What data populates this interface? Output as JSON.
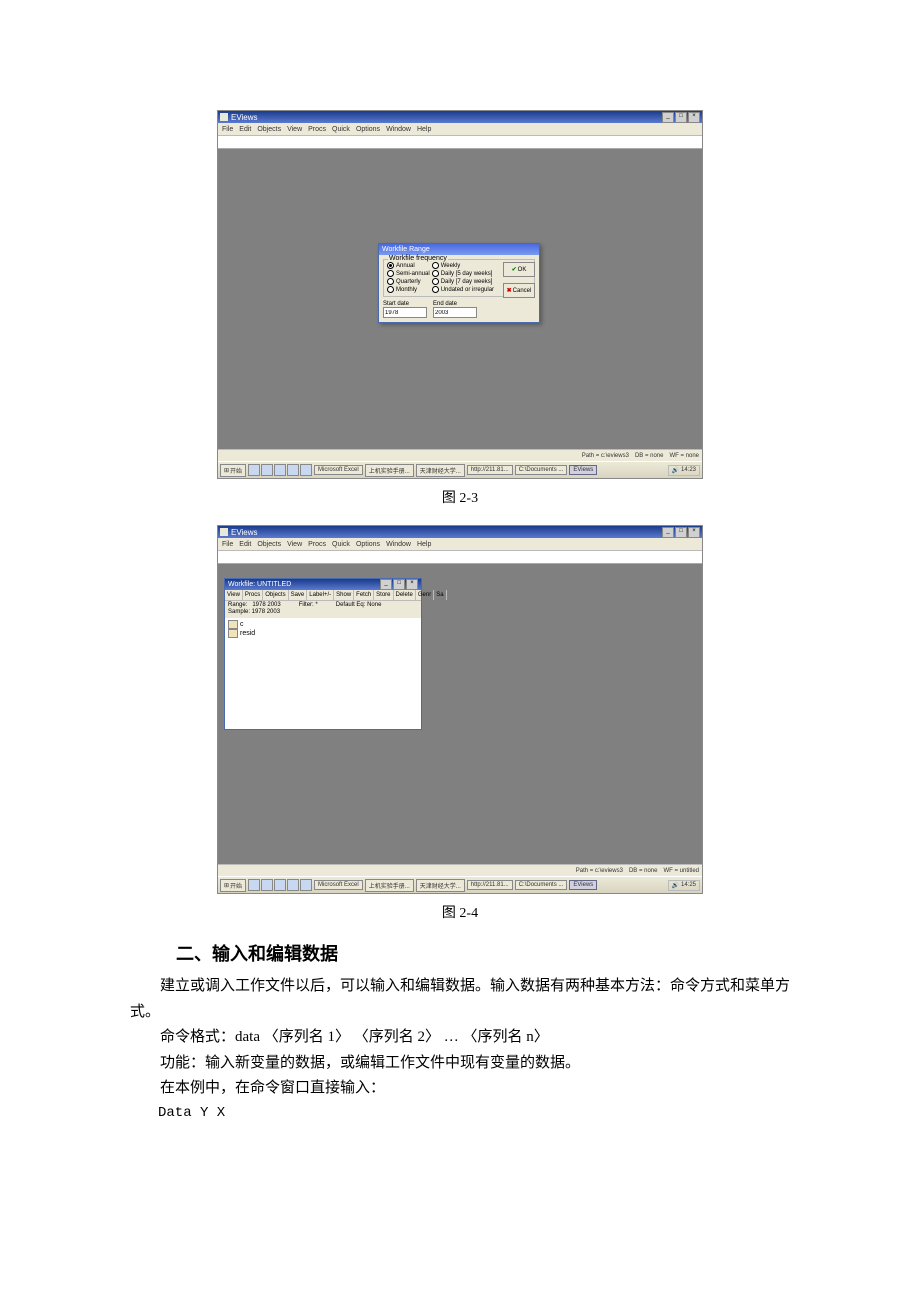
{
  "app": {
    "title": "EViews",
    "menus": [
      "File",
      "Edit",
      "Objects",
      "View",
      "Procs",
      "Quick",
      "Options",
      "Window",
      "Help"
    ]
  },
  "screenshot1": {
    "dialog_title": "Workfile Range",
    "freq_group_label": "Workfile frequency",
    "frequencies_col1": [
      "Annual",
      "Semi-annual",
      "Quarterly",
      "Monthly"
    ],
    "frequencies_col2": [
      "Weekly",
      "Daily [5 day weeks]",
      "Daily [7 day weeks]",
      "Undated or irregular"
    ],
    "selected_frequency": "Annual",
    "start_label": "Start date",
    "start_value": "1978",
    "end_label": "End date",
    "end_value": "2003",
    "ok_label": "OK",
    "cancel_label": "Cancel",
    "status": {
      "path": "Path = c:\\eviews3",
      "db": "DB = none",
      "wf": "WF = none"
    },
    "time": "14:23"
  },
  "screenshot2": {
    "child_title": "Workfile: UNTITLED",
    "toolbar": [
      "View",
      "Procs",
      "Objects",
      "Save",
      "Label+/-",
      "Show",
      "Fetch",
      "Store",
      "Delete",
      "Genr",
      "Sa"
    ],
    "range": "Range:   1978 2003",
    "sample": "Sample: 1978 2003",
    "filter": "Filter: *",
    "default_eq": "Default Eq: None",
    "objects": [
      "c",
      "resid"
    ],
    "status": {
      "path": "Path = c:\\eviews3",
      "db": "DB = none",
      "wf": "WF = untitled"
    },
    "time": "14:25"
  },
  "taskbar": {
    "start": "开始",
    "items": [
      "Microsoft Excel",
      "上机实验手册...",
      "天津财经大学...",
      "http://211.81...",
      "C:\\Documents ...",
      "EViews"
    ]
  },
  "captions": {
    "fig23": "图 2-3",
    "fig24": "图 2-4"
  },
  "text": {
    "section_heading": "二、输入和编辑数据",
    "p1": "建立或调入工作文件以后，可以输入和编辑数据。输入数据有两种基本方法：命令方式和菜单方式。",
    "p2": "命令格式：data  〈序列名 1〉  〈序列名 2〉  …  〈序列名 n〉",
    "p3": "功能：输入新变量的数据，或编辑工作文件中现有变量的数据。",
    "p4": "在本例中，在命令窗口直接输入：",
    "p5": "Data  Y  X"
  }
}
